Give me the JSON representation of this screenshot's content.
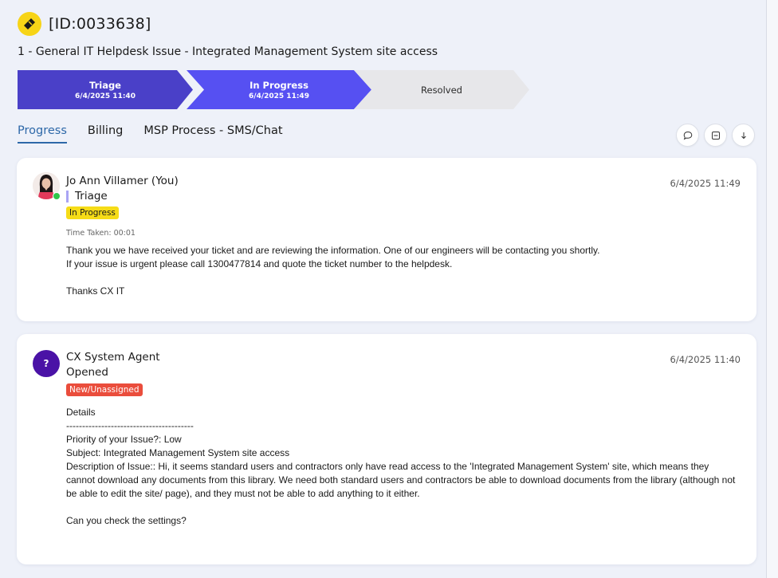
{
  "header": {
    "ticket_id": "[ID:0033638]",
    "subtitle": "1 - General IT Helpdesk Issue - Integrated Management System site access",
    "icon": "ticket-icon",
    "icon_color": "#f7d417"
  },
  "steps": [
    {
      "label": "Triage",
      "date": "6/4/2025 11:40",
      "color": "#4a40c8"
    },
    {
      "label": "In Progress",
      "date": "6/4/2025 11:49",
      "color": "#5650f2"
    },
    {
      "label": "Resolved",
      "date": "",
      "color": "#e7e7ea"
    }
  ],
  "tabs": [
    {
      "label": "Progress",
      "active": true
    },
    {
      "label": "Billing",
      "active": false
    },
    {
      "label": "MSP Process - SMS/Chat",
      "active": false
    }
  ],
  "tab_actions": [
    "comment-icon",
    "collapse-icon",
    "download-icon"
  ],
  "entries": [
    {
      "author": "Jo Ann Villamer (You)",
      "timestamp": "6/4/2025 11:49",
      "stage": "Triage",
      "status": "In Progress",
      "status_color": "#f6dc17",
      "time_taken": "Time Taken: 00:01",
      "lines": [
        "Thank you we have received your ticket and are reviewing the information. One of our engineers will be contacting you shortly.",
        "If your issue is urgent please call 1300477814 and quote the ticket number to the helpdesk.",
        "",
        "Thanks CX IT"
      ]
    },
    {
      "author": "CX System Agent",
      "avatar_text": "?",
      "timestamp": "6/4/2025 11:40",
      "stage": "Opened",
      "status": "New/Unassigned",
      "status_color": "#ea4d3c",
      "lines": [
        "Details",
        "----------------------------------------",
        "Priority of your Issue?: Low",
        "Subject: Integrated Management System site access",
        "Description of Issue:: Hi, it seems standard users and contractors only have read access to the 'Integrated Management System' site, which means they cannot download any documents from this library. We need both standard users and contractors be able to download documents from the library (although not be able to edit the site/ page), and they must not be able to add anything to it either.",
        "",
        "Can you check the settings?"
      ]
    }
  ]
}
